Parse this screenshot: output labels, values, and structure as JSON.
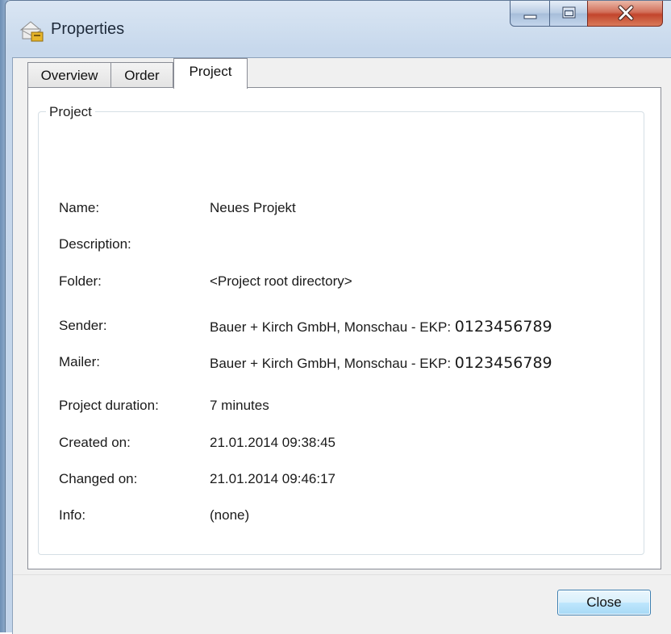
{
  "window": {
    "title": "Properties",
    "icon": "properties-folder-icon",
    "controls": {
      "minimize": "minimize-icon",
      "maximize": "maximize-icon",
      "close": "close-icon"
    }
  },
  "tabs": [
    {
      "label": "Overview",
      "selected": false
    },
    {
      "label": "Order",
      "selected": false
    },
    {
      "label": "Project",
      "selected": true
    }
  ],
  "group": {
    "label": "Project",
    "fields": [
      {
        "label": "Name:",
        "value": "Neues Projekt"
      },
      {
        "label": "Description:",
        "value": ""
      },
      {
        "label": "Folder:",
        "value": "<Project root directory>"
      },
      {
        "label": "Sender:",
        "value": "Bauer + Kirch GmbH, Monschau - EKP: ",
        "number": "0123456789"
      },
      {
        "label": "Mailer:",
        "value": "Bauer + Kirch GmbH, Monschau - EKP: ",
        "number": "0123456789"
      },
      {
        "label": "Project duration:",
        "value": "7 minutes"
      },
      {
        "label": "Created on:",
        "value": "21.01.2014 09:38:45"
      },
      {
        "label": "Changed on:",
        "value": "21.01.2014 09:46:17"
      },
      {
        "label": "Info:",
        "value": "(none)"
      }
    ]
  },
  "buttons": {
    "close_label": "Close"
  },
  "colors": {
    "close_button_hover": "#bee6fd",
    "title_close": "#c2452c"
  }
}
